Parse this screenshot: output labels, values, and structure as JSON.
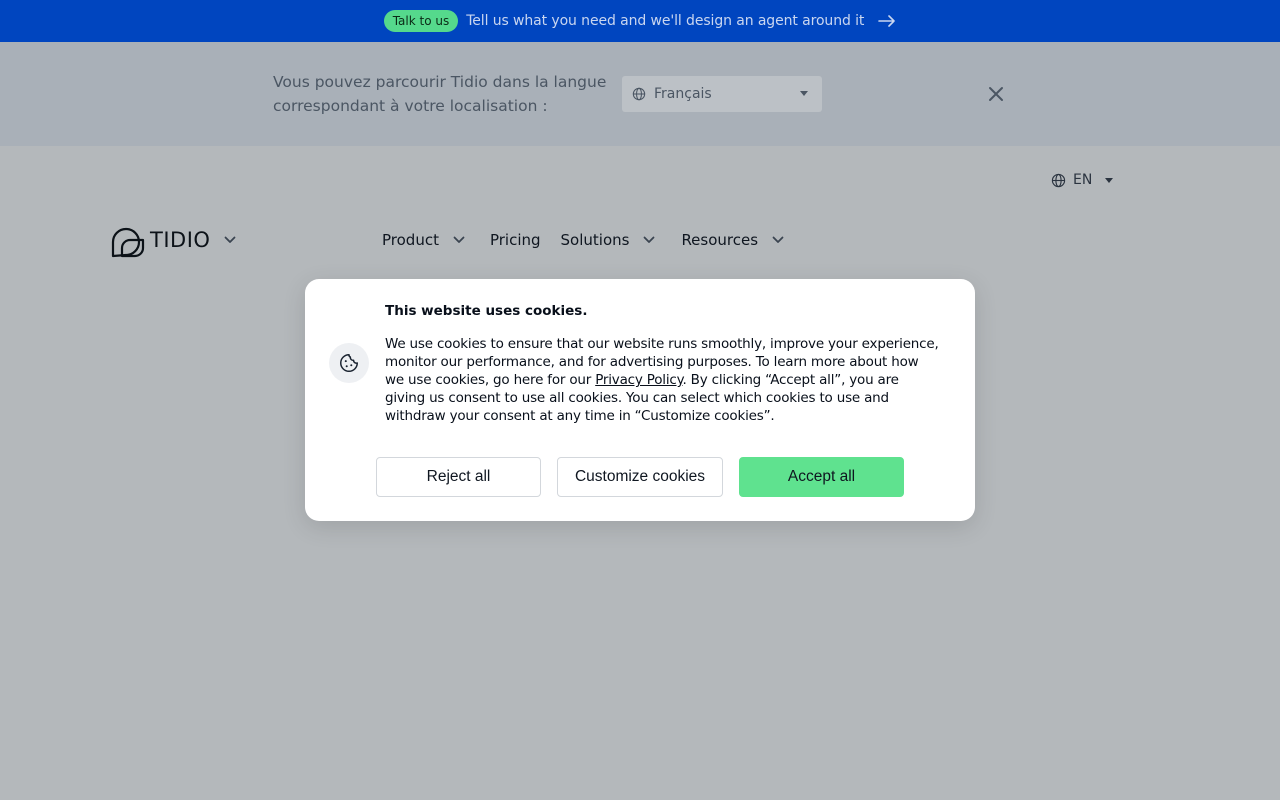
{
  "promo": {
    "badge": "Talk to us",
    "text": "Tell us what you need and we'll design an agent around it"
  },
  "language_banner": {
    "message": "Vous pouvez parcourir Tidio dans la langue correspondant à votre localisation :",
    "selected_language": "Français"
  },
  "header": {
    "language_switch": "EN",
    "logo_text": "TIDIO",
    "nav": {
      "product": "Product",
      "pricing": "Pricing",
      "solutions": "Solutions",
      "resources": "Resources"
    }
  },
  "cookie_dialog": {
    "title": "This website uses cookies.",
    "body_part1": "We use cookies to ensure that our website runs smoothly, improve your experience, monitor our performance, and for advertising purposes. To learn more about how we use cookies, go here for our ",
    "privacy_link": "Privacy Policy",
    "body_part2": ". By clicking “Accept all”, you are giving us consent to use all cookies. You can select which cookies to use and withdraw your consent at any time in “Customize cookies”.",
    "reject_label": "Reject all",
    "customize_label": "Customize cookies",
    "accept_label": "Accept all"
  },
  "icons": {
    "promo_arrow": "arrow-right-icon",
    "language_globe": "globe-icon",
    "close": "close-icon",
    "cookie": "cookie-icon",
    "chevron": "chevron-down-icon"
  },
  "colors": {
    "promo_bar": "#0045bf",
    "badge": "#55d98c",
    "accept_button": "#5fe28f",
    "overlay_bg": "#b4b8bb"
  }
}
